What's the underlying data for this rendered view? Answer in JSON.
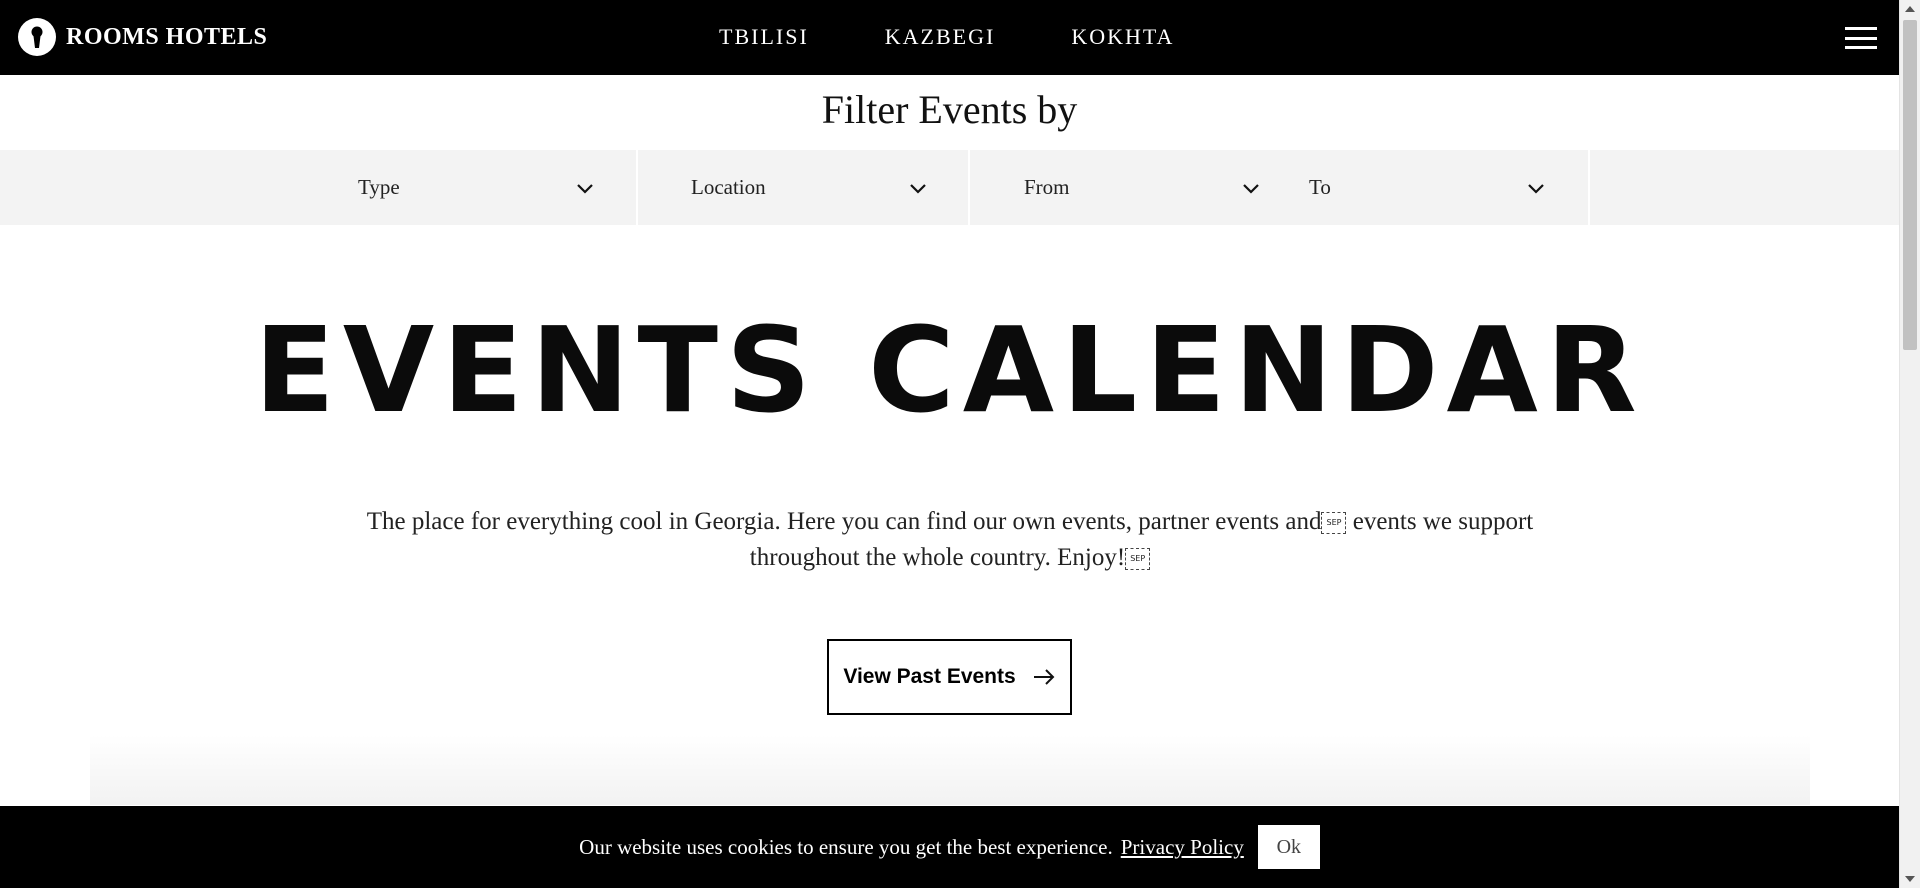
{
  "header": {
    "brand": "ROOMS HOTELS",
    "nav": [
      "TBILISI",
      "KAZBEGI",
      "KOKHTA"
    ]
  },
  "filters": {
    "title": "Filter Events by",
    "items": [
      "Type",
      "Location",
      "From",
      "To"
    ]
  },
  "hero": {
    "title": "EVENTS CALENDAR",
    "intro_part1": "The place for everything cool in Georgia. Here you can find our own events, partner events and",
    "intro_part2": " events we support throughout the whole country. Enjoy!",
    "sep_label": "SEP"
  },
  "past_button": {
    "label": "View Past Events"
  },
  "cookie": {
    "message": "Our website uses cookies to ensure you get the best experience.",
    "link": "Privacy Policy",
    "button": "Ok"
  },
  "colors": {
    "header_bg": "#000000",
    "filter_bg": "#f3f3f3",
    "text": "#111111"
  },
  "icons": [
    "keyhole-logo-icon",
    "menu-icon",
    "chevron-down-icon",
    "arrow-right-icon"
  ]
}
